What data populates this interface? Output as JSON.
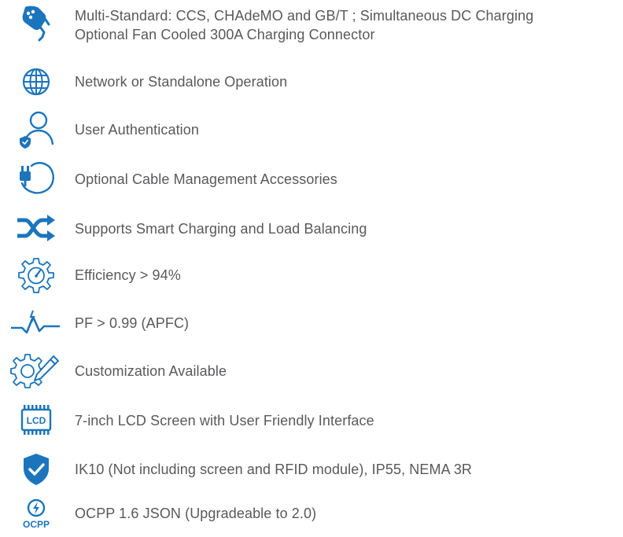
{
  "accent_color": "#1c75bc",
  "text_color": "#58595b",
  "features": [
    {
      "icon": "charging-connector-icon",
      "lines": [
        "Multi-Standard: CCS, CHAdeMO and GB/T ; Simultaneous DC Charging",
        "Optional Fan Cooled 300A Charging Connector"
      ]
    },
    {
      "icon": "globe-icon",
      "lines": [
        "Network or Standalone Operation"
      ]
    },
    {
      "icon": "user-shield-icon",
      "lines": [
        "User Authentication"
      ]
    },
    {
      "icon": "plug-cable-icon",
      "lines": [
        "Optional Cable Management Accessories"
      ]
    },
    {
      "icon": "shuffle-arrows-icon",
      "lines": [
        "Supports Smart Charging and Load Balancing"
      ]
    },
    {
      "icon": "gear-gauge-icon",
      "lines": [
        "Efficiency > 94%"
      ]
    },
    {
      "icon": "power-wave-icon",
      "lines": [
        "PF > 0.99 (APFC)"
      ]
    },
    {
      "icon": "gear-pencil-icon",
      "lines": [
        "Customization Available"
      ]
    },
    {
      "icon": "lcd-screen-icon",
      "icon_text": "LCD",
      "lines": [
        "7-inch LCD Screen with User Friendly Interface"
      ]
    },
    {
      "icon": "shield-check-icon",
      "lines": [
        "IK10 (Not including screen and RFID module), IP55, NEMA 3R"
      ]
    },
    {
      "icon": "ocpp-logo-icon",
      "icon_text": "OCPP",
      "lines": [
        "OCPP 1.6 JSON (Upgradeable to 2.0)"
      ]
    }
  ]
}
